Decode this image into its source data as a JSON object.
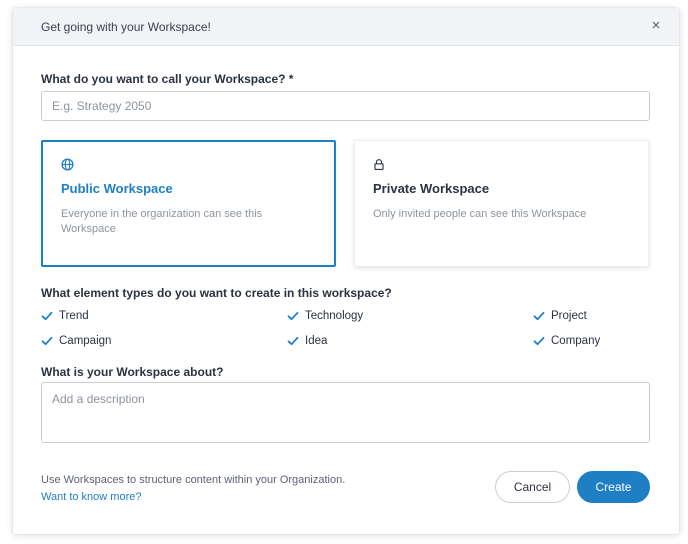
{
  "dialog": {
    "title": "Get going with your Workspace!",
    "close_icon": "×"
  },
  "name_field": {
    "label": "What do you want to call your Workspace? *",
    "placeholder": "E.g. Strategy 2050",
    "value": ""
  },
  "visibility": {
    "options": [
      {
        "icon": "globe-icon",
        "title": "Public Workspace",
        "description": "Everyone in the organization can see this Workspace",
        "selected": true
      },
      {
        "icon": "lock-icon",
        "title": "Private Workspace",
        "description": "Only invited people can see this Workspace",
        "selected": false
      }
    ]
  },
  "element_types": {
    "label": "What element types do you want to create in this workspace?",
    "items": [
      {
        "label": "Trend",
        "checked": true
      },
      {
        "label": "Technology",
        "checked": true
      },
      {
        "label": "Project",
        "checked": true
      },
      {
        "label": "Campaign",
        "checked": true
      },
      {
        "label": "Idea",
        "checked": true
      },
      {
        "label": "Company",
        "checked": true
      }
    ]
  },
  "description_field": {
    "label": "What is your Workspace about?",
    "placeholder": "Add a description",
    "value": ""
  },
  "footer": {
    "info_text": "Use Workspaces to structure content within your Organization.",
    "link_text": "Want to know more?",
    "cancel_label": "Cancel",
    "create_label": "Create"
  },
  "colors": {
    "accent": "#1f7fc4",
    "text": "#2b3240",
    "muted": "#8d949e",
    "header_bg": "#f1f3f6"
  }
}
